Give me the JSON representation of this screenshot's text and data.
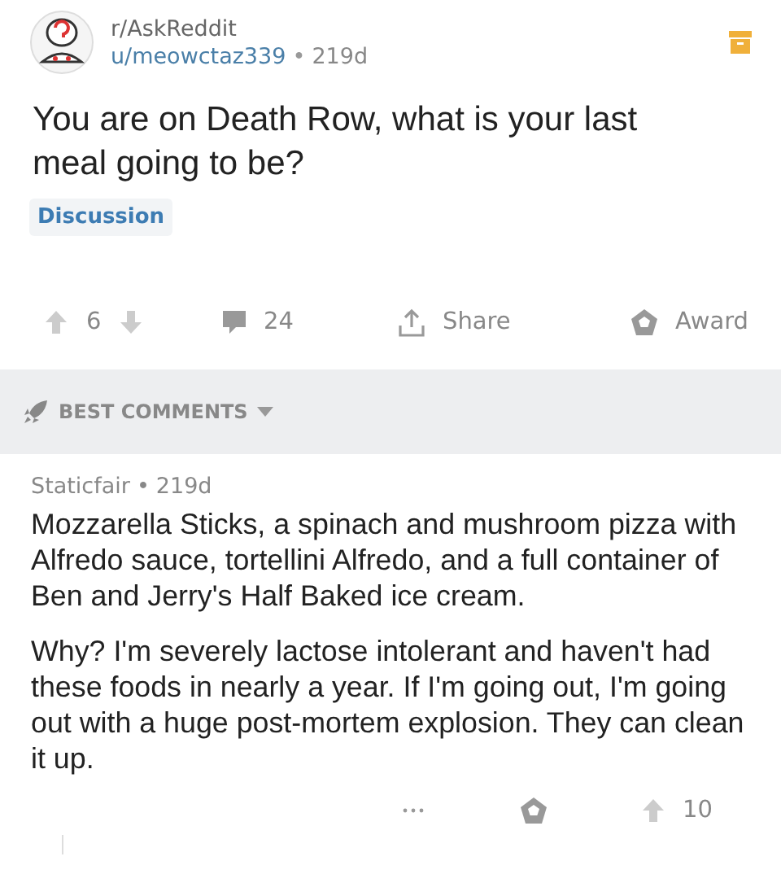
{
  "post": {
    "subreddit": "r/AskReddit",
    "author": "u/meowctaz339",
    "separator": "•",
    "age": "219d",
    "title": "You are on Death Row, what is your last meal going to be?",
    "flair": "Discussion"
  },
  "actions": {
    "score": "6",
    "comments": "24",
    "share": "Share",
    "award": "Award"
  },
  "sort": {
    "label": "BEST COMMENTS"
  },
  "comments": [
    {
      "author": "Staticfair",
      "separator": "•",
      "age": "219d",
      "paragraphs": [
        "Mozzarella Sticks, a spinach and mushroom pizza with Alfredo sauce, tortellini Alfredo, and a full container of Ben and Jerry's Half Baked ice cream.",
        "Why? I'm severely lactose intolerant and haven't had these foods in nearly a year. If I'm going out, I'm going out with a huge post-mortem explosion. They can clean it up."
      ],
      "score": "10"
    }
  ]
}
